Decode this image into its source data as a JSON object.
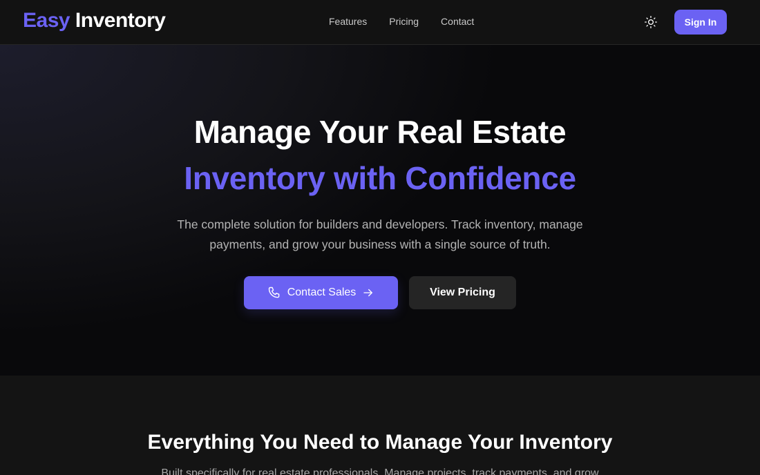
{
  "nav": {
    "logo_accent": "Easy",
    "logo_rest": "Inventory",
    "links": [
      "Features",
      "Pricing",
      "Contact"
    ],
    "theme_icon": "sun-icon",
    "signin_label": "Sign In"
  },
  "hero": {
    "title_line1": "Manage Your Real Estate",
    "title_line2": "Inventory with Confidence",
    "subtitle_line1": "The complete solution for builders and developers. Track inventory, manage",
    "subtitle_line2": "payments, and grow your business with a single source of truth.",
    "primary_cta": {
      "label": "Contact Sales",
      "leading_icon": "phone-icon",
      "trailing_icon": "arrow-right-icon"
    },
    "secondary_cta": {
      "label": "View Pricing"
    }
  },
  "features": {
    "title": "Everything You Need to Manage Your Inventory",
    "subtitle": "Built specifically for real estate professionals. Manage projects, track payments, and grow"
  },
  "colors": {
    "accent": "#6b62f3",
    "background": "#121212",
    "hero_background": "#0a0a0c",
    "secondary_button": "#252525"
  }
}
